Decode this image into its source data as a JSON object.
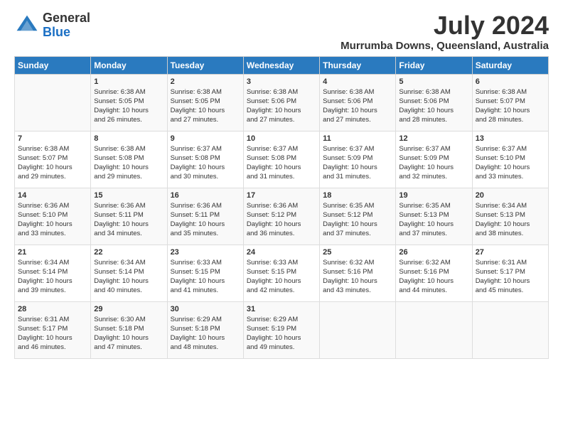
{
  "header": {
    "logo_line1": "General",
    "logo_line2": "Blue",
    "month": "July 2024",
    "location": "Murrumba Downs, Queensland, Australia"
  },
  "days_of_week": [
    "Sunday",
    "Monday",
    "Tuesday",
    "Wednesday",
    "Thursday",
    "Friday",
    "Saturday"
  ],
  "weeks": [
    [
      {
        "day": "",
        "info": ""
      },
      {
        "day": "1",
        "info": "Sunrise: 6:38 AM\nSunset: 5:05 PM\nDaylight: 10 hours\nand 26 minutes."
      },
      {
        "day": "2",
        "info": "Sunrise: 6:38 AM\nSunset: 5:05 PM\nDaylight: 10 hours\nand 27 minutes."
      },
      {
        "day": "3",
        "info": "Sunrise: 6:38 AM\nSunset: 5:06 PM\nDaylight: 10 hours\nand 27 minutes."
      },
      {
        "day": "4",
        "info": "Sunrise: 6:38 AM\nSunset: 5:06 PM\nDaylight: 10 hours\nand 27 minutes."
      },
      {
        "day": "5",
        "info": "Sunrise: 6:38 AM\nSunset: 5:06 PM\nDaylight: 10 hours\nand 28 minutes."
      },
      {
        "day": "6",
        "info": "Sunrise: 6:38 AM\nSunset: 5:07 PM\nDaylight: 10 hours\nand 28 minutes."
      }
    ],
    [
      {
        "day": "7",
        "info": "Sunrise: 6:38 AM\nSunset: 5:07 PM\nDaylight: 10 hours\nand 29 minutes."
      },
      {
        "day": "8",
        "info": "Sunrise: 6:38 AM\nSunset: 5:08 PM\nDaylight: 10 hours\nand 29 minutes."
      },
      {
        "day": "9",
        "info": "Sunrise: 6:37 AM\nSunset: 5:08 PM\nDaylight: 10 hours\nand 30 minutes."
      },
      {
        "day": "10",
        "info": "Sunrise: 6:37 AM\nSunset: 5:08 PM\nDaylight: 10 hours\nand 31 minutes."
      },
      {
        "day": "11",
        "info": "Sunrise: 6:37 AM\nSunset: 5:09 PM\nDaylight: 10 hours\nand 31 minutes."
      },
      {
        "day": "12",
        "info": "Sunrise: 6:37 AM\nSunset: 5:09 PM\nDaylight: 10 hours\nand 32 minutes."
      },
      {
        "day": "13",
        "info": "Sunrise: 6:37 AM\nSunset: 5:10 PM\nDaylight: 10 hours\nand 33 minutes."
      }
    ],
    [
      {
        "day": "14",
        "info": "Sunrise: 6:36 AM\nSunset: 5:10 PM\nDaylight: 10 hours\nand 33 minutes."
      },
      {
        "day": "15",
        "info": "Sunrise: 6:36 AM\nSunset: 5:11 PM\nDaylight: 10 hours\nand 34 minutes."
      },
      {
        "day": "16",
        "info": "Sunrise: 6:36 AM\nSunset: 5:11 PM\nDaylight: 10 hours\nand 35 minutes."
      },
      {
        "day": "17",
        "info": "Sunrise: 6:36 AM\nSunset: 5:12 PM\nDaylight: 10 hours\nand 36 minutes."
      },
      {
        "day": "18",
        "info": "Sunrise: 6:35 AM\nSunset: 5:12 PM\nDaylight: 10 hours\nand 37 minutes."
      },
      {
        "day": "19",
        "info": "Sunrise: 6:35 AM\nSunset: 5:13 PM\nDaylight: 10 hours\nand 37 minutes."
      },
      {
        "day": "20",
        "info": "Sunrise: 6:34 AM\nSunset: 5:13 PM\nDaylight: 10 hours\nand 38 minutes."
      }
    ],
    [
      {
        "day": "21",
        "info": "Sunrise: 6:34 AM\nSunset: 5:14 PM\nDaylight: 10 hours\nand 39 minutes."
      },
      {
        "day": "22",
        "info": "Sunrise: 6:34 AM\nSunset: 5:14 PM\nDaylight: 10 hours\nand 40 minutes."
      },
      {
        "day": "23",
        "info": "Sunrise: 6:33 AM\nSunset: 5:15 PM\nDaylight: 10 hours\nand 41 minutes."
      },
      {
        "day": "24",
        "info": "Sunrise: 6:33 AM\nSunset: 5:15 PM\nDaylight: 10 hours\nand 42 minutes."
      },
      {
        "day": "25",
        "info": "Sunrise: 6:32 AM\nSunset: 5:16 PM\nDaylight: 10 hours\nand 43 minutes."
      },
      {
        "day": "26",
        "info": "Sunrise: 6:32 AM\nSunset: 5:16 PM\nDaylight: 10 hours\nand 44 minutes."
      },
      {
        "day": "27",
        "info": "Sunrise: 6:31 AM\nSunset: 5:17 PM\nDaylight: 10 hours\nand 45 minutes."
      }
    ],
    [
      {
        "day": "28",
        "info": "Sunrise: 6:31 AM\nSunset: 5:17 PM\nDaylight: 10 hours\nand 46 minutes."
      },
      {
        "day": "29",
        "info": "Sunrise: 6:30 AM\nSunset: 5:18 PM\nDaylight: 10 hours\nand 47 minutes."
      },
      {
        "day": "30",
        "info": "Sunrise: 6:29 AM\nSunset: 5:18 PM\nDaylight: 10 hours\nand 48 minutes."
      },
      {
        "day": "31",
        "info": "Sunrise: 6:29 AM\nSunset: 5:19 PM\nDaylight: 10 hours\nand 49 minutes."
      },
      {
        "day": "",
        "info": ""
      },
      {
        "day": "",
        "info": ""
      },
      {
        "day": "",
        "info": ""
      }
    ]
  ]
}
